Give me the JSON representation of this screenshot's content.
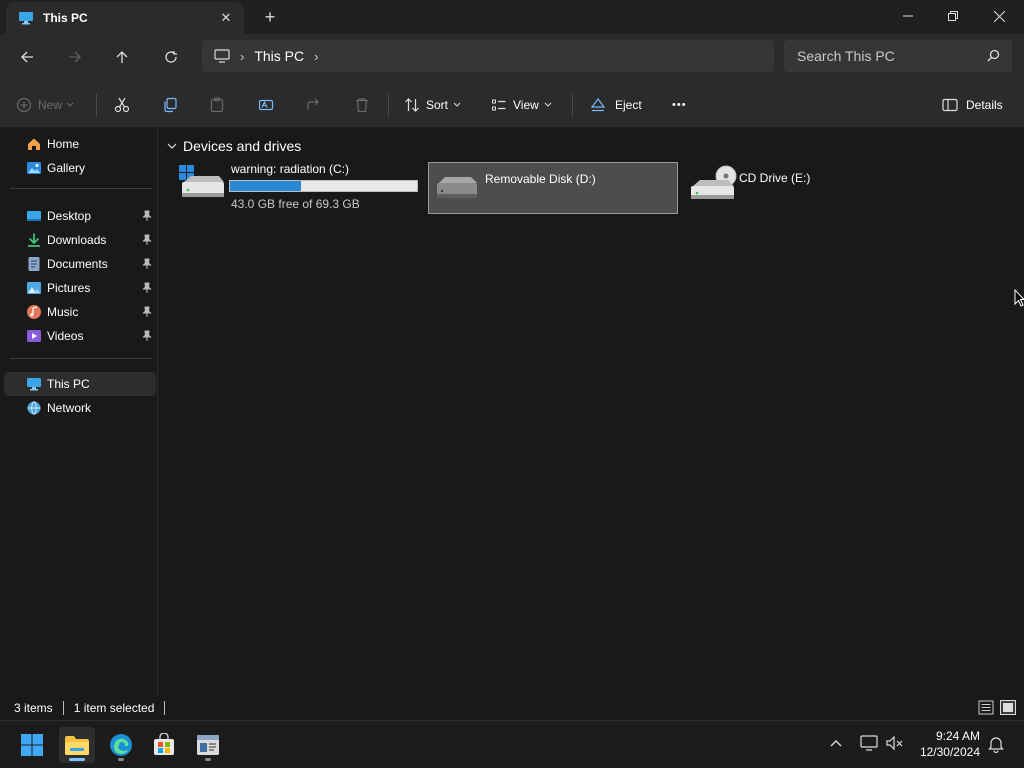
{
  "window": {
    "tab_title": "This PC",
    "new_tab_symbol": "+"
  },
  "address": {
    "crumbs": [
      "This PC"
    ],
    "search_placeholder": "Search This PC"
  },
  "commands": {
    "new_label": "New",
    "sort_label": "Sort",
    "view_label": "View",
    "eject_label": "Eject",
    "more_symbol": "•••",
    "details_label": "Details"
  },
  "sidebar": {
    "items": [
      {
        "label": "Home",
        "icon": "home-icon"
      },
      {
        "label": "Gallery",
        "icon": "gallery-icon"
      },
      {
        "label": "Desktop",
        "icon": "desktop-folder-icon",
        "pinned": true
      },
      {
        "label": "Downloads",
        "icon": "downloads-icon",
        "pinned": true
      },
      {
        "label": "Documents",
        "icon": "documents-icon",
        "pinned": true
      },
      {
        "label": "Pictures",
        "icon": "pictures-icon",
        "pinned": true
      },
      {
        "label": "Music",
        "icon": "music-icon",
        "pinned": true
      },
      {
        "label": "Videos",
        "icon": "videos-icon",
        "pinned": true
      },
      {
        "label": "This PC",
        "icon": "this-pc-icon",
        "selected": true
      },
      {
        "label": "Network",
        "icon": "network-icon"
      }
    ]
  },
  "main": {
    "group_title": "Devices and drives",
    "drives": [
      {
        "name": "warning: radiation (C:)",
        "free_text": "43.0 GB free of 69.3 GB",
        "used_fraction": 0.38,
        "icon": "system-drive-icon"
      },
      {
        "name": "Removable Disk (D:)",
        "icon": "removable-drive-icon",
        "selected": true
      },
      {
        "name": "CD Drive (E:)",
        "icon": "cd-drive-icon"
      }
    ]
  },
  "status": {
    "item_count": "3 items",
    "selection": "1 item selected"
  },
  "taskbar": {
    "time": "9:24 AM",
    "date": "12/30/2024"
  },
  "colors": {
    "accent": "#2789d4",
    "folder": "#f5c242"
  }
}
